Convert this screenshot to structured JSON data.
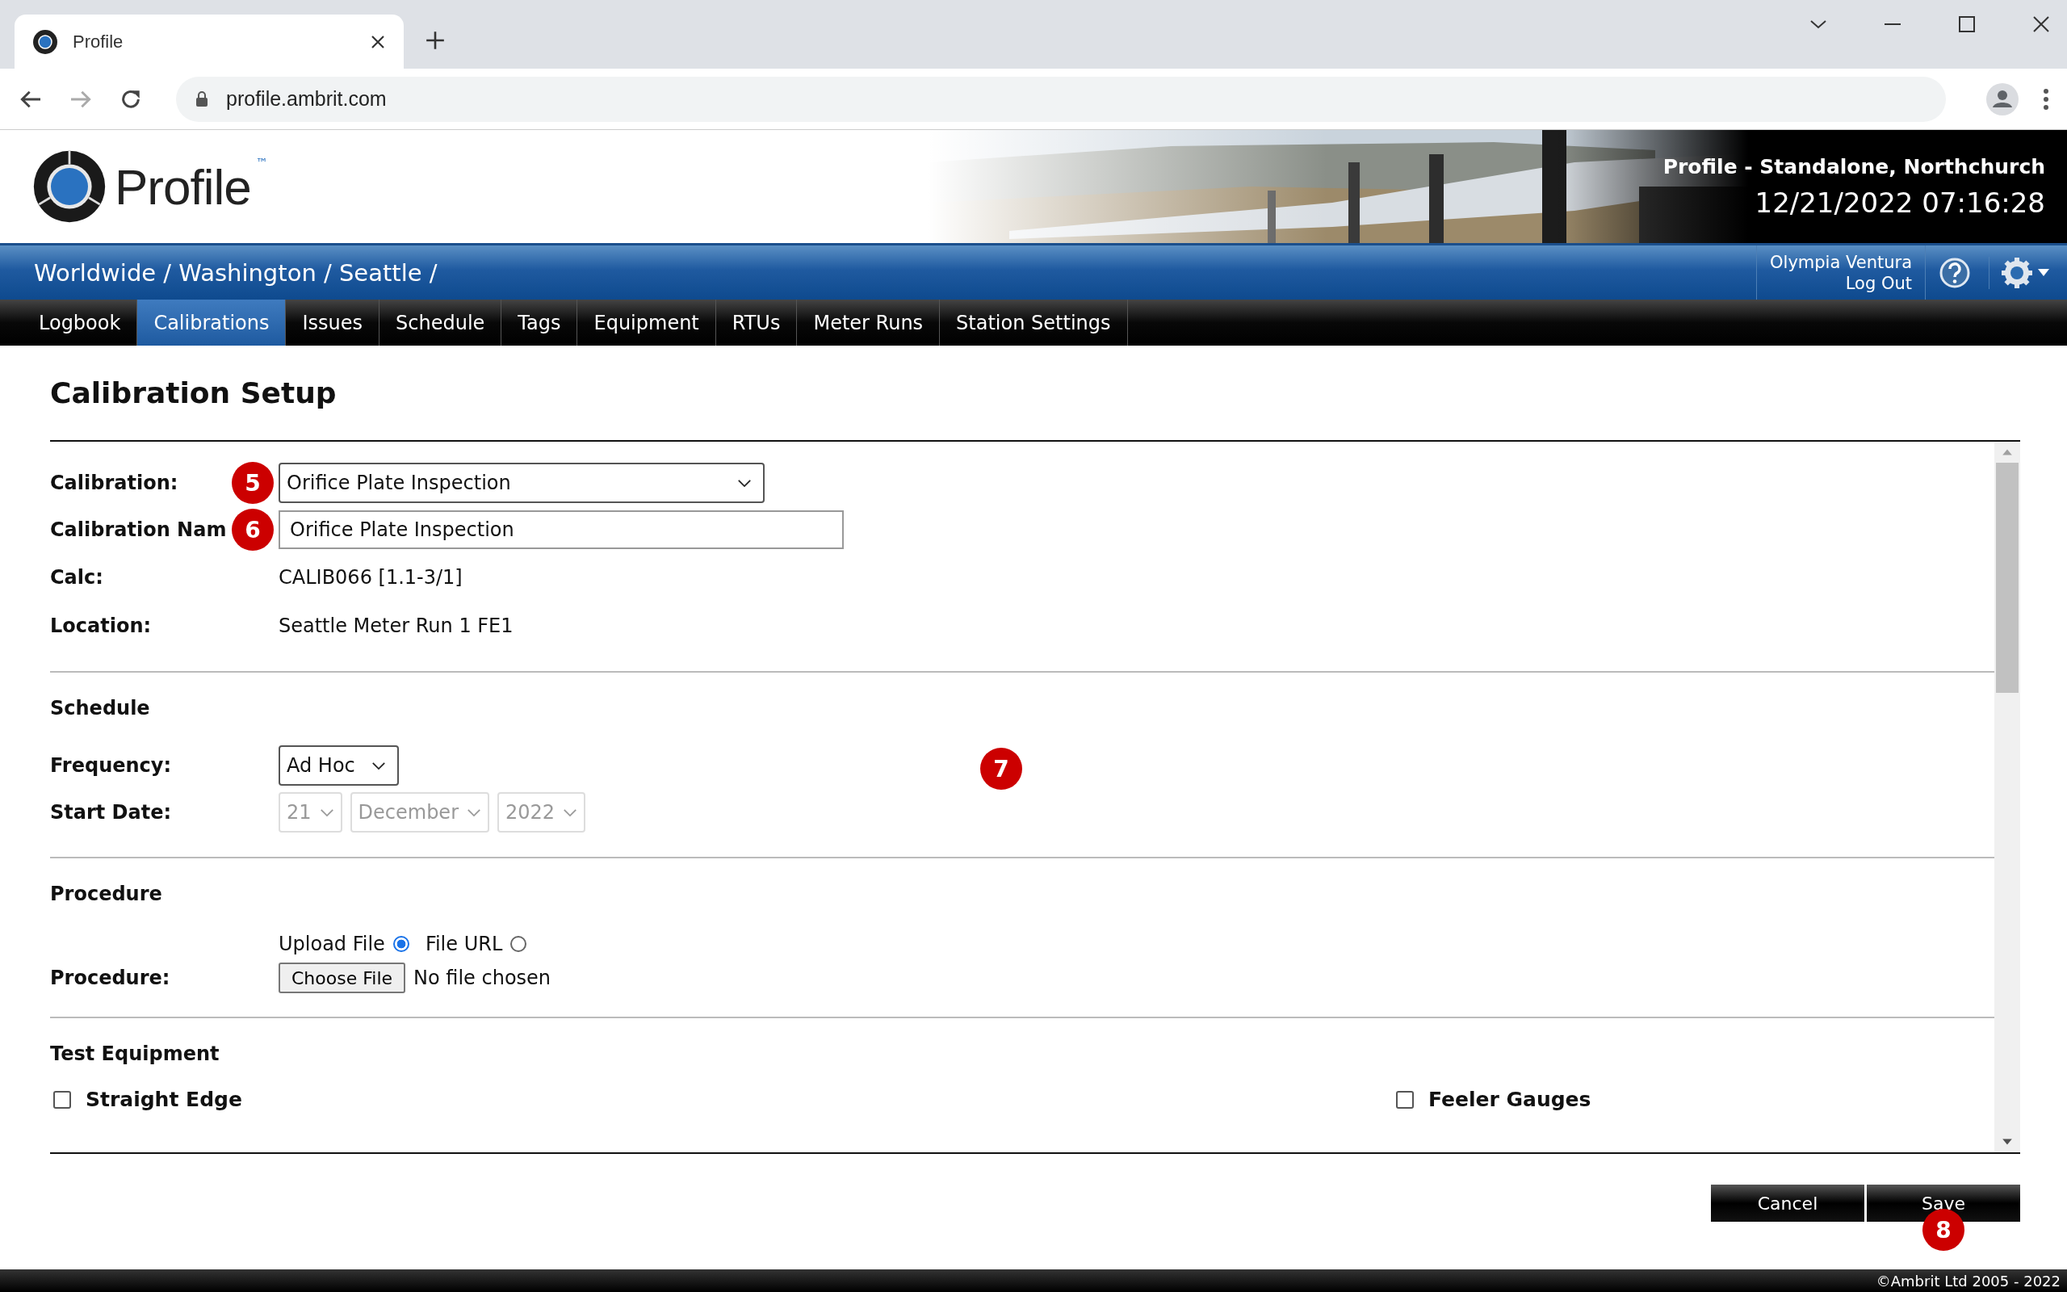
{
  "browser": {
    "tab_title": "Profile",
    "url": "profile.ambrit.com"
  },
  "header": {
    "logo_text": "Profile",
    "trademark": "™",
    "system_title": "Profile - Standalone, Northchurch",
    "datetime": "12/21/2022 07:16:28"
  },
  "breadcrumb": "Worldwide / Washington / Seattle /",
  "user": {
    "name": "Olympia Ventura",
    "logout": "Log Out"
  },
  "nav": [
    {
      "label": "Logbook",
      "selected": false
    },
    {
      "label": "Calibrations",
      "selected": true
    },
    {
      "label": "Issues",
      "selected": false
    },
    {
      "label": "Schedule",
      "selected": false
    },
    {
      "label": "Tags",
      "selected": false
    },
    {
      "label": "Equipment",
      "selected": false
    },
    {
      "label": "RTUs",
      "selected": false
    },
    {
      "label": "Meter Runs",
      "selected": false
    },
    {
      "label": "Station Settings",
      "selected": false
    }
  ],
  "page_title": "Calibration Setup",
  "details": {
    "calibration": {
      "label": "Calibration:",
      "value": "Orifice Plate Inspection"
    },
    "calibration_name": {
      "label": "Calibration Nam",
      "value": "Orifice Plate Inspection"
    },
    "calc": {
      "label": "Calc:",
      "value": "CALIB066 [1.1-3/1]"
    },
    "location": {
      "label": "Location:",
      "value": "Seattle Meter Run 1 FE1"
    }
  },
  "schedule": {
    "heading": "Schedule",
    "frequency": {
      "label": "Frequency:",
      "value": "Ad Hoc"
    },
    "start_date": {
      "label": "Start Date:",
      "day": "21",
      "month": "December",
      "year": "2022",
      "disabled": true
    }
  },
  "procedure": {
    "heading": "Procedure",
    "label": "Procedure:",
    "sources": [
      {
        "label": "Upload File",
        "selected": true
      },
      {
        "label": "File URL",
        "selected": false
      }
    ],
    "file_button": "Choose File",
    "file_status": "No file chosen"
  },
  "test_equipment": {
    "heading": "Test Equipment",
    "items": [
      {
        "label": "Straight Edge",
        "checked": false
      },
      {
        "label": "Feeler Gauges",
        "checked": false
      }
    ]
  },
  "buttons": [
    "Cancel",
    "Save"
  ],
  "markers": [
    {
      "label": "5"
    },
    {
      "label": "6"
    },
    {
      "label": "7"
    },
    {
      "label": "8"
    }
  ],
  "footer": "©Ambrit Ltd 2005 - 2022"
}
